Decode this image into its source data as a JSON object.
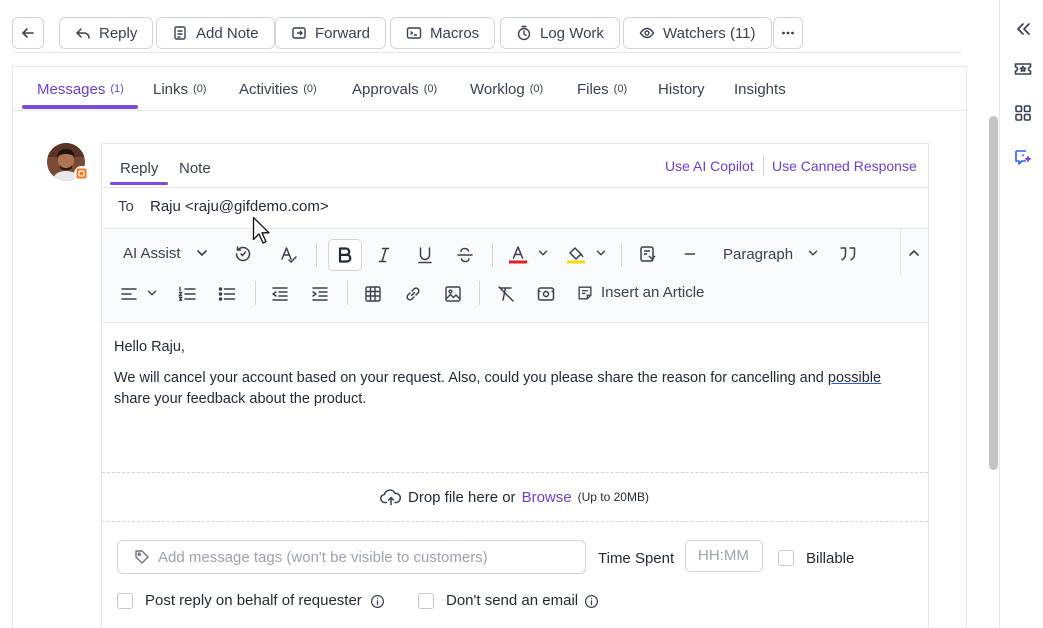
{
  "toolbar": {
    "reply": "Reply",
    "add_note": "Add Note",
    "forward": "Forward",
    "macros": "Macros",
    "log_work": "Log Work",
    "watchers": "Watchers (11)"
  },
  "tabs": [
    {
      "label": "Messages",
      "count": "(1)"
    },
    {
      "label": "Links",
      "count": "(0)"
    },
    {
      "label": "Activities",
      "count": "(0)"
    },
    {
      "label": "Approvals",
      "count": "(0)"
    },
    {
      "label": "Worklog",
      "count": "(0)"
    },
    {
      "label": "Files",
      "count": "(0)"
    },
    {
      "label": "History",
      "count": ""
    },
    {
      "label": "Insights",
      "count": ""
    }
  ],
  "composer": {
    "tab_reply": "Reply",
    "tab_note": "Note",
    "ai_copilot": "Use AI Copilot",
    "canned": "Use Canned Response",
    "to_label": "To",
    "to_value": "Raju <raju@gifdemo.com>"
  },
  "editor": {
    "ai_assist": "AI Assist",
    "paragraph": "Paragraph",
    "insert_article": "Insert an Article"
  },
  "message": {
    "greeting": "Hello Raju,",
    "body_before": "We will cancel your account based on your request. Also, could you please share the reason for cancelling and ",
    "body_underlined": "possible",
    "body_after": " share your feedback about the product."
  },
  "drop": {
    "text": "Drop file here or",
    "browse": "Browse",
    "limit": "(Up to 20MB)"
  },
  "footer": {
    "tags_placeholder": "Add message tags (won't be visible to customers)",
    "time_spent": "Time Spent",
    "time_placeholder": "HH:MM",
    "billable": "Billable",
    "post_on_behalf": "Post reply on behalf of requester",
    "dont_send": "Don't send an email"
  },
  "colors": {
    "accent": "#6d3fd6",
    "font_red": "#e11d2a",
    "highlight_yellow": "#f5d90a"
  }
}
